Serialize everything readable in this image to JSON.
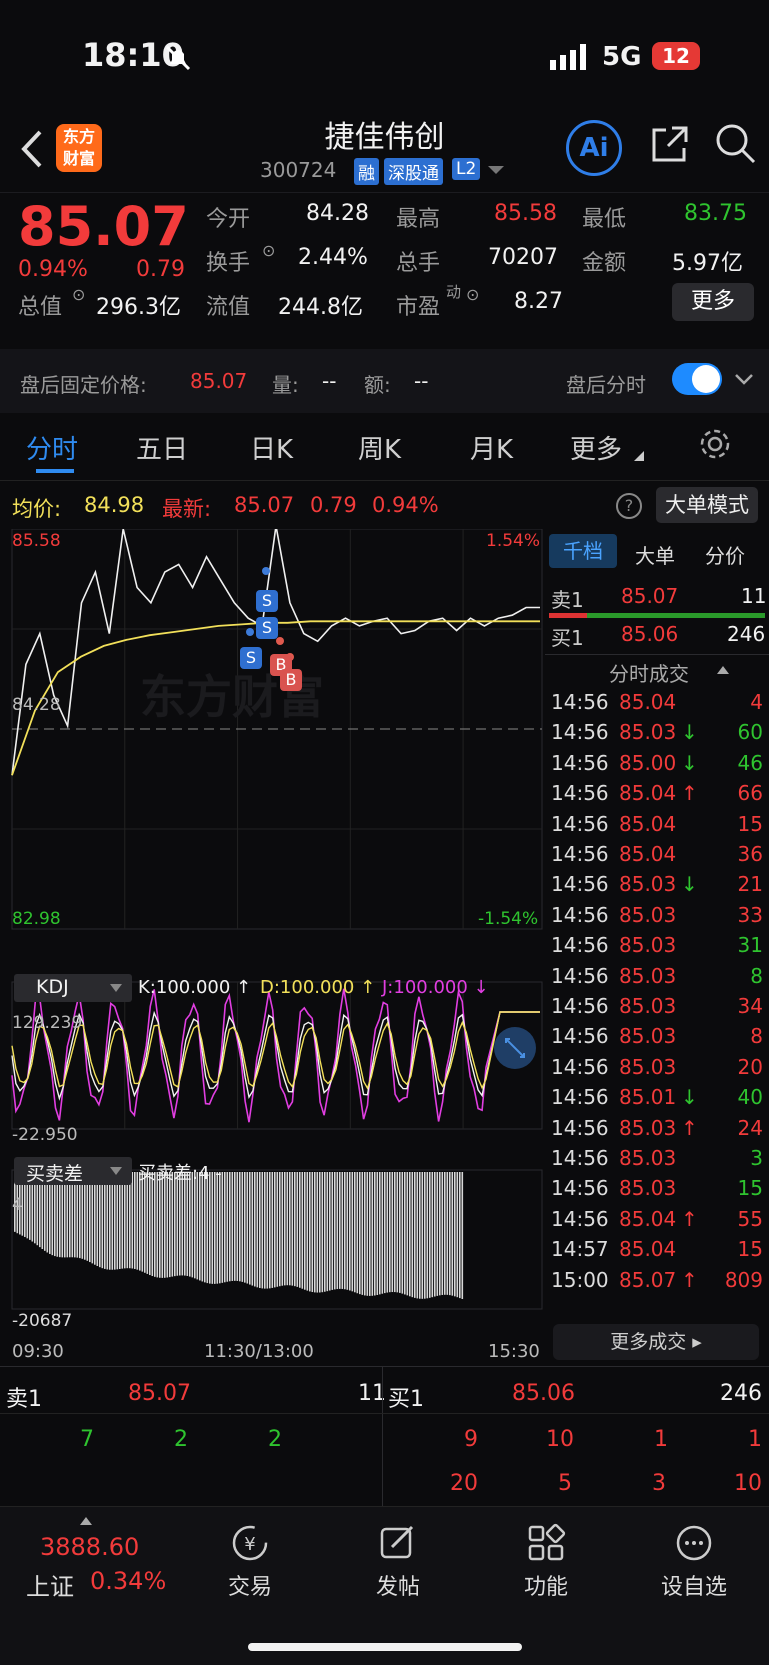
{
  "status_bar": {
    "time": "18:10",
    "network": "5G",
    "battery": "12"
  },
  "header": {
    "back_icon": "chevron-left-icon",
    "logo_text_line1": "东方",
    "logo_text_line2": "财富",
    "title": "捷佳伟创",
    "code": "300724",
    "tags": [
      "融",
      "深股通",
      "L2"
    ],
    "ai_label": "Ai"
  },
  "quote": {
    "price": "85.07",
    "change_pct": "0.94%",
    "change": "0.79",
    "open_label": "今开",
    "open": "84.28",
    "high_label": "最高",
    "high": "85.58",
    "low_label": "最低",
    "low": "83.75",
    "turnover_label": "换手",
    "turnover": "2.44%",
    "volume_label": "总手",
    "volume": "70207",
    "amount_label": "金额",
    "amount": "5.97亿",
    "mktcap_label": "总值",
    "mktcap": "296.3亿",
    "float_label": "流值",
    "float": "244.8亿",
    "pe_label": "市盈",
    "pe_sup": "动",
    "pe": "8.27",
    "more_button": "更多"
  },
  "after_hours": {
    "price_label": "盘后固定价格:",
    "price": "85.07",
    "vol_label": "量:",
    "vol": "--",
    "amt_label": "额:",
    "amt": "--",
    "toggle_label": "盘后分时",
    "toggle_on": true
  },
  "tabs": [
    "分时",
    "五日",
    "日K",
    "周K",
    "月K",
    "更多"
  ],
  "chart_info": {
    "avg_label": "均价:",
    "avg": "84.98",
    "latest_label": "最新:",
    "latest": "85.07",
    "latest_chg": "0.79",
    "latest_pct": "0.94%",
    "mode_button": "大单模式"
  },
  "chart_data": [
    {
      "type": "line",
      "title": "分时",
      "y_max": "85.58",
      "y_min": "82.98",
      "y_ref": "84.28",
      "pct_max": "1.54%",
      "pct_min": "-1.54%",
      "series": [
        {
          "name": "价格",
          "values": [
            83.98,
            84.7,
            84.9,
            84.5,
            84.3,
            85.1,
            85.3,
            84.9,
            85.58,
            85.2,
            85.1,
            85.3,
            85.35,
            85.2,
            85.4,
            85.25,
            85.1,
            85.0,
            84.95,
            85.6,
            85.1,
            84.9,
            84.85,
            84.95,
            85.0,
            84.95,
            84.98,
            85.0,
            84.9,
            84.92,
            84.98,
            85.0,
            84.92,
            85.0,
            84.95,
            85.0,
            85.02,
            85.07,
            85.07
          ]
        },
        {
          "name": "均价",
          "values": [
            83.98,
            84.4,
            84.65,
            84.75,
            84.82,
            84.86,
            84.89,
            84.91,
            84.93,
            84.95,
            84.96,
            84.97,
            84.97,
            84.98,
            84.98,
            84.98,
            84.98,
            84.98,
            84.98,
            84.98,
            84.98,
            84.98,
            84.98,
            84.98
          ]
        }
      ],
      "x_labels": [
        "09:30",
        "11:30/13:00",
        "15:30"
      ]
    },
    {
      "type": "line",
      "title": "KDJ",
      "indicator_label": "KDJ",
      "k": "K:100.000 ↑",
      "d": "D:100.000 ↑",
      "j": "J:100.000 ↓",
      "y_max": "129.239",
      "y_min": "-22.950"
    },
    {
      "type": "bar",
      "title": "买卖差",
      "indicator_label": "买卖差",
      "value_label": "买卖差:4 -",
      "y_max": "4",
      "y_min": "-20687"
    }
  ],
  "orderbook": {
    "tabs": [
      "千档",
      "大单",
      "分价"
    ],
    "ask1": {
      "label": "卖1",
      "price": "85.07",
      "vol": "11"
    },
    "bid1": {
      "label": "买1",
      "price": "85.06",
      "vol": "246"
    },
    "trades_header": "分时成交",
    "trades": [
      {
        "t": "14:56",
        "p": "85.04",
        "a": "",
        "v": "4",
        "c": "red"
      },
      {
        "t": "14:56",
        "p": "85.03",
        "a": "↓",
        "v": "60",
        "c": "green"
      },
      {
        "t": "14:56",
        "p": "85.00",
        "a": "↓",
        "v": "46",
        "c": "green"
      },
      {
        "t": "14:56",
        "p": "85.04",
        "a": "↑",
        "v": "66",
        "c": "red"
      },
      {
        "t": "14:56",
        "p": "85.04",
        "a": "",
        "v": "15",
        "c": "red"
      },
      {
        "t": "14:56",
        "p": "85.04",
        "a": "",
        "v": "36",
        "c": "red"
      },
      {
        "t": "14:56",
        "p": "85.03",
        "a": "↓",
        "v": "21",
        "c": "red"
      },
      {
        "t": "14:56",
        "p": "85.03",
        "a": "",
        "v": "33",
        "c": "red"
      },
      {
        "t": "14:56",
        "p": "85.03",
        "a": "",
        "v": "31",
        "c": "green"
      },
      {
        "t": "14:56",
        "p": "85.03",
        "a": "",
        "v": "8",
        "c": "green"
      },
      {
        "t": "14:56",
        "p": "85.03",
        "a": "",
        "v": "34",
        "c": "red"
      },
      {
        "t": "14:56",
        "p": "85.03",
        "a": "",
        "v": "8",
        "c": "red"
      },
      {
        "t": "14:56",
        "p": "85.03",
        "a": "",
        "v": "20",
        "c": "red"
      },
      {
        "t": "14:56",
        "p": "85.01",
        "a": "↓",
        "v": "40",
        "c": "green"
      },
      {
        "t": "14:56",
        "p": "85.03",
        "a": "↑",
        "v": "24",
        "c": "red"
      },
      {
        "t": "14:56",
        "p": "85.03",
        "a": "",
        "v": "3",
        "c": "green"
      },
      {
        "t": "14:56",
        "p": "85.03",
        "a": "",
        "v": "15",
        "c": "green"
      },
      {
        "t": "14:56",
        "p": "85.04",
        "a": "↑",
        "v": "55",
        "c": "red"
      },
      {
        "t": "14:57",
        "p": "85.04",
        "a": "",
        "v": "15",
        "c": "red"
      },
      {
        "t": "15:00",
        "p": "85.07",
        "a": "↑",
        "v": "809",
        "c": "red"
      }
    ],
    "more_trades": "更多成交"
  },
  "depth": {
    "ask_label": "卖1",
    "ask_price": "85.07",
    "ask_vol": "11",
    "bid_label": "买1",
    "bid_price": "85.06",
    "bid_vol": "246",
    "ask_row": [
      "7",
      "2",
      "2"
    ],
    "bid_row1": [
      "9",
      "10",
      "1",
      "1"
    ],
    "bid_row2": [
      "20",
      "5",
      "3",
      "10"
    ]
  },
  "bottom_nav": {
    "index_value": "3888.60",
    "index_name": "上证",
    "index_pct": "0.34%",
    "items": [
      {
        "label": "交易",
        "icon": "trade-yen-icon"
      },
      {
        "label": "发帖",
        "icon": "compose-icon"
      },
      {
        "label": "功能",
        "icon": "grid-icon"
      },
      {
        "label": "设自选",
        "icon": "more-circle-icon"
      }
    ]
  },
  "colors": {
    "up": "#f23b3b",
    "down": "#2fc42f",
    "avg_line": "#f2e05a",
    "accent": "#1e8bff"
  }
}
